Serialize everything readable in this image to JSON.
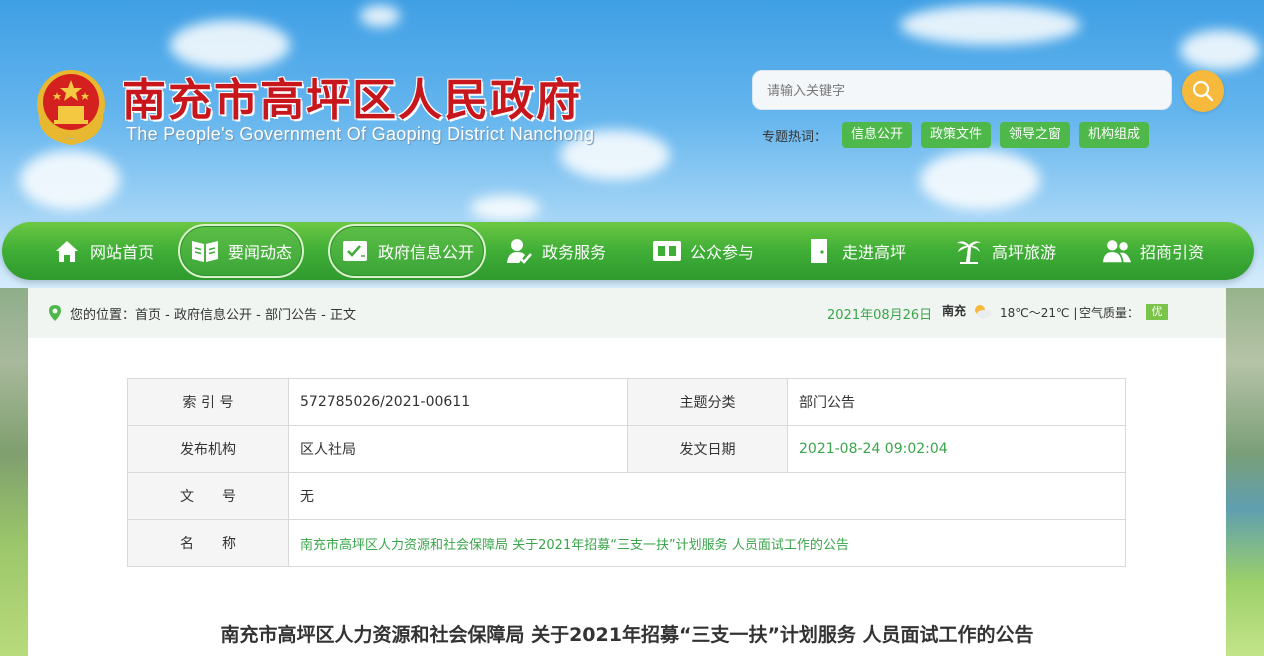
{
  "header": {
    "title": "南充市高坪区人民政府",
    "subtitle": "The People's Government Of Gaoping District Nanchong",
    "search_placeholder": "请输入关键字",
    "hot_label": "专题热词：",
    "hot_tags": [
      "信息公开",
      "政策文件",
      "领导之窗",
      "机构组成"
    ]
  },
  "nav": {
    "items": [
      {
        "label": "网站首页",
        "icon": "home-icon"
      },
      {
        "label": "要闻动态",
        "icon": "book-icon"
      },
      {
        "label": "政府信息公开",
        "icon": "check-doc-icon"
      },
      {
        "label": "政务服务",
        "icon": "user-check-icon"
      },
      {
        "label": "公众参与",
        "icon": "grid-icon"
      },
      {
        "label": "走进高坪",
        "icon": "door-icon"
      },
      {
        "label": "高坪旅游",
        "icon": "palm-tree-icon"
      },
      {
        "label": "招商引资",
        "icon": "users-icon"
      }
    ]
  },
  "breadcrumb": {
    "prefix": "您的位置：",
    "items": [
      "首页",
      "政府信息公开",
      "部门公告",
      "正文"
    ],
    "separator": " - "
  },
  "status": {
    "date": "2021年08月26日",
    "city": "南充",
    "temperature": "18℃～21℃",
    "air_label": "空气质量：",
    "air_value": "优"
  },
  "info": {
    "index_label": "索 引 号",
    "index_value": "572785026/2021-00611",
    "category_label": "主题分类",
    "category_value": "部门公告",
    "publisher_label": "发布机构",
    "publisher_value": "区人社局",
    "date_label": "发文日期",
    "date_value": "2021-08-24 09:02:04",
    "docno_label": "文　　号",
    "docno_value": "无",
    "name_label": "名　　称",
    "name_value": "南充市高坪区人力资源和社会保障局 关于2021年招募“三支一扶”计划服务 人员面试工作的公告"
  },
  "article": {
    "title": "南充市高坪区人力资源和社会保障局 关于2021年招募“三支一扶”计划服务 人员面试工作的公告"
  },
  "colors": {
    "title_red": "#c8161d",
    "nav_green": "#3fae36",
    "accent_green": "#3aa54a",
    "search_orange": "#f6b93b"
  }
}
